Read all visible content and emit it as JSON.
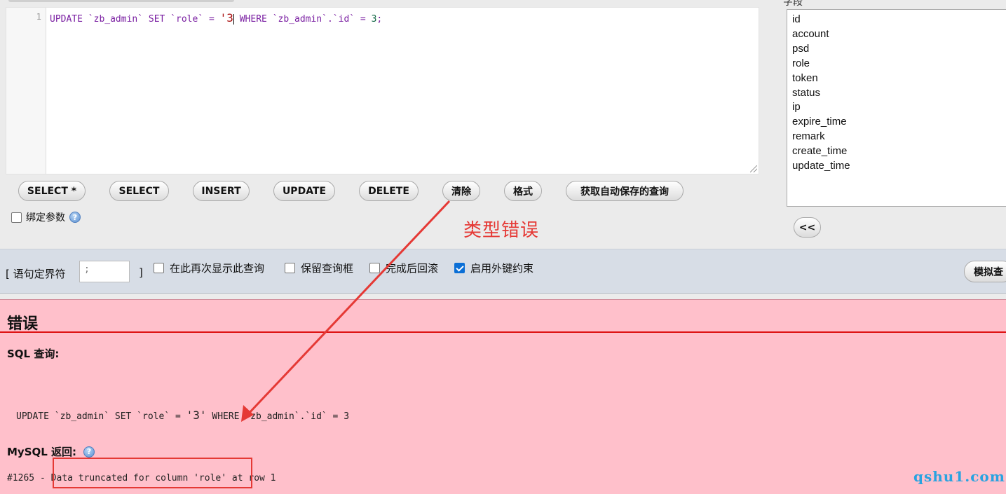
{
  "editor": {
    "line_number": "1",
    "code": {
      "p1": "UPDATE `zb_admin` SET `role` = ",
      "str": "'3",
      "p2": " WHERE `zb_admin`.`id` = ",
      "num": "3",
      "end": ";"
    }
  },
  "buttons": {
    "select_star": "SELECT *",
    "select": "SELECT",
    "insert": "INSERT",
    "update": "UPDATE",
    "delete": "DELETE",
    "clear": "清除",
    "format": "格式",
    "get_autosaved": "获取自动保存的查询"
  },
  "bind_params": {
    "label": "绑定参数",
    "checked": false
  },
  "columns_header_fragment": "字段",
  "columns": [
    "id",
    "account",
    "psd",
    "role",
    "token",
    "status",
    "ip",
    "expire_time",
    "remark",
    "create_time",
    "update_time"
  ],
  "insert_column_button": "<<",
  "annotation": {
    "type_error": "类型错误",
    "color": "#e53935"
  },
  "options": {
    "delimiter_label_open": "[ 语句定界符",
    "delimiter_value": ";",
    "delimiter_label_close": "]",
    "show_again": {
      "label": "在此再次显示此查询",
      "checked": false
    },
    "retain_box": {
      "label": "保留查询框",
      "checked": false
    },
    "rollback": {
      "label": "完成后回滚",
      "checked": false
    },
    "foreign_keys": {
      "label": "启用外键约束",
      "checked": true
    },
    "simulate_button": "模拟查"
  },
  "error": {
    "title": "错误",
    "sql_query_label": "SQL 查询:",
    "sql": {
      "p1": "UPDATE `zb_admin` SET `role` = ",
      "str": "'3'",
      "p2": " WHERE `zb_admin`.`id` = 3"
    },
    "mysql_label": "MySQL 返回:",
    "message": "#1265 - Data truncated for column 'role' at row 1"
  },
  "watermark": "qshu1.com",
  "colors": {
    "error_bg": "#ffc0cb",
    "options_bg": "#d7dde6",
    "accent_blue": "#0b6fd6"
  }
}
